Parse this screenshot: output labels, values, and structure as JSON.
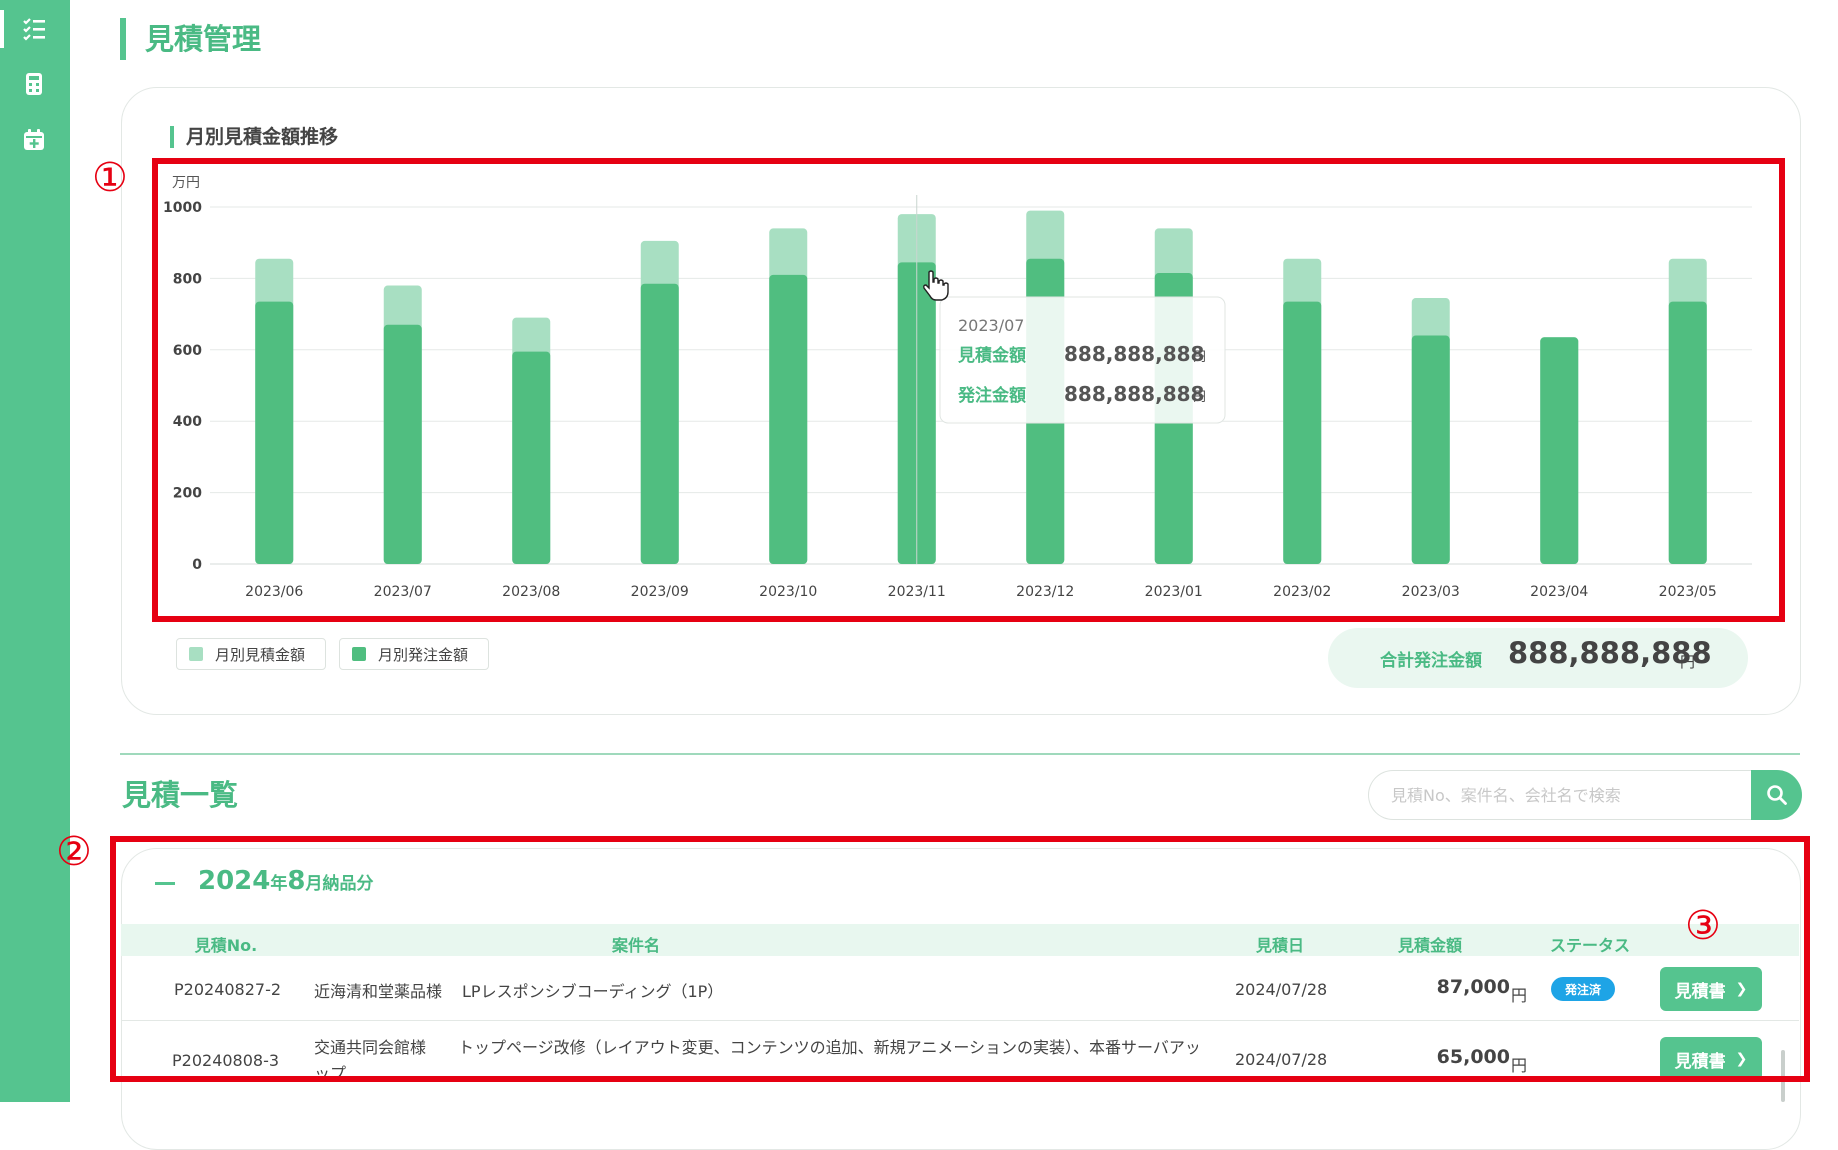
{
  "page_title": "見積管理",
  "sidebar": {
    "items": [
      {
        "icon": "task-list-icon",
        "active": true
      },
      {
        "icon": "calculator-icon",
        "active": false
      },
      {
        "icon": "calendar-add-icon",
        "active": false
      }
    ]
  },
  "chart": {
    "subtitle": "月別見積金額推移",
    "unit_label": "万円",
    "tooltip": {
      "month": "2023/07",
      "estimate_label": "見積金額",
      "estimate_value": "888,888,888",
      "order_label": "発注金額",
      "order_value": "888,888,888",
      "unit": "円"
    },
    "legend": {
      "estimate": "月別見積金額",
      "order": "月別発注金額"
    },
    "total_label": "合計発注金額",
    "total_value": "888,888,888",
    "total_unit": "円"
  },
  "chart_data": {
    "type": "bar",
    "categories": [
      "2023/06",
      "2023/07",
      "2023/08",
      "2023/09",
      "2023/10",
      "2023/11",
      "2023/12",
      "2023/01",
      "2023/02",
      "2023/03",
      "2023/04",
      "2023/05"
    ],
    "series": [
      {
        "name": "月別見積金額",
        "color": "#a8dfc2",
        "values": [
          855,
          780,
          690,
          905,
          940,
          980,
          990,
          940,
          855,
          745,
          635,
          855
        ]
      },
      {
        "name": "月別発注金額",
        "color": "#50be80",
        "values": [
          735,
          670,
          595,
          785,
          810,
          845,
          855,
          815,
          735,
          640,
          635,
          735
        ]
      }
    ],
    "ylabel": "万円",
    "yticks": [
      0,
      200,
      400,
      600,
      800,
      1000
    ],
    "ylim": [
      0,
      1000
    ],
    "grid": true,
    "hover_category": "2023/11"
  },
  "list": {
    "title": "見積一覧",
    "search_placeholder": "見積No、案件名、会社名で検索",
    "group": {
      "year_label": "2024",
      "year_suffix": "年",
      "month_label": "8",
      "month_suffix": "月納品分"
    },
    "columns": {
      "no": "見積No.",
      "name": "案件名",
      "date": "見積日",
      "amount": "見積金額",
      "status": "ステータス"
    },
    "rows": [
      {
        "no": "P20240827-2",
        "company": "近海清和堂薬品様",
        "project": "LPレスポンシブコーディング（1P）",
        "project_cont": "",
        "date": "2024/07/28",
        "amount": "87,000",
        "unit": "円",
        "status": "発注済",
        "button": "見積書"
      },
      {
        "no": "P20240808-3",
        "company": "交通共同会館様",
        "project": "トップページ改修（レイアウト変更、コンテンツの追加、新規アニメーションの実装）、本番サーバアッ",
        "project_cont": "ップ",
        "date": "2024/07/28",
        "amount": "65,000",
        "unit": "円",
        "status": "",
        "button": "見積書"
      }
    ]
  },
  "annotations": [
    "①",
    "②",
    "③"
  ],
  "colors": {
    "accent": "#55c48f",
    "accent_light": "#a8dfc2",
    "accent_dark": "#50be80",
    "annotation": "#e60012",
    "badge": "#1ea4e6"
  }
}
